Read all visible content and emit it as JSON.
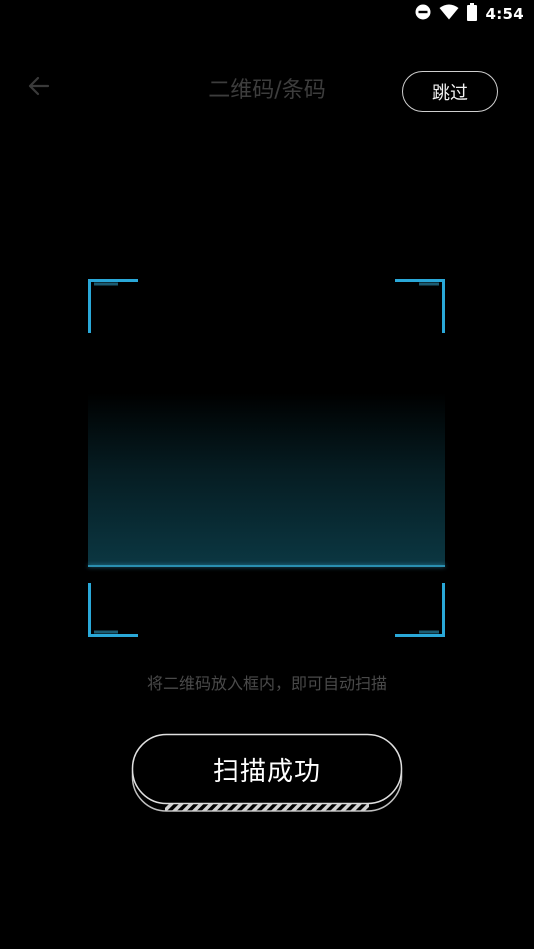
{
  "status_bar": {
    "time": "4:54",
    "icons": [
      "do-not-disturb-icon",
      "wifi-icon",
      "battery-icon"
    ]
  },
  "header": {
    "title": "二维码/条码",
    "skip_label": "跳过",
    "back_icon": "arrow-left-icon"
  },
  "scanner": {
    "hint": "将二维码放入框内，即可自动扫描",
    "accent_color": "#2aa8d8"
  },
  "result": {
    "label": "扫描成功"
  },
  "colors": {
    "background": "#000000",
    "title": "#3d3d3d",
    "hint": "#4a4a4a",
    "corner": "#2aa8d8"
  }
}
